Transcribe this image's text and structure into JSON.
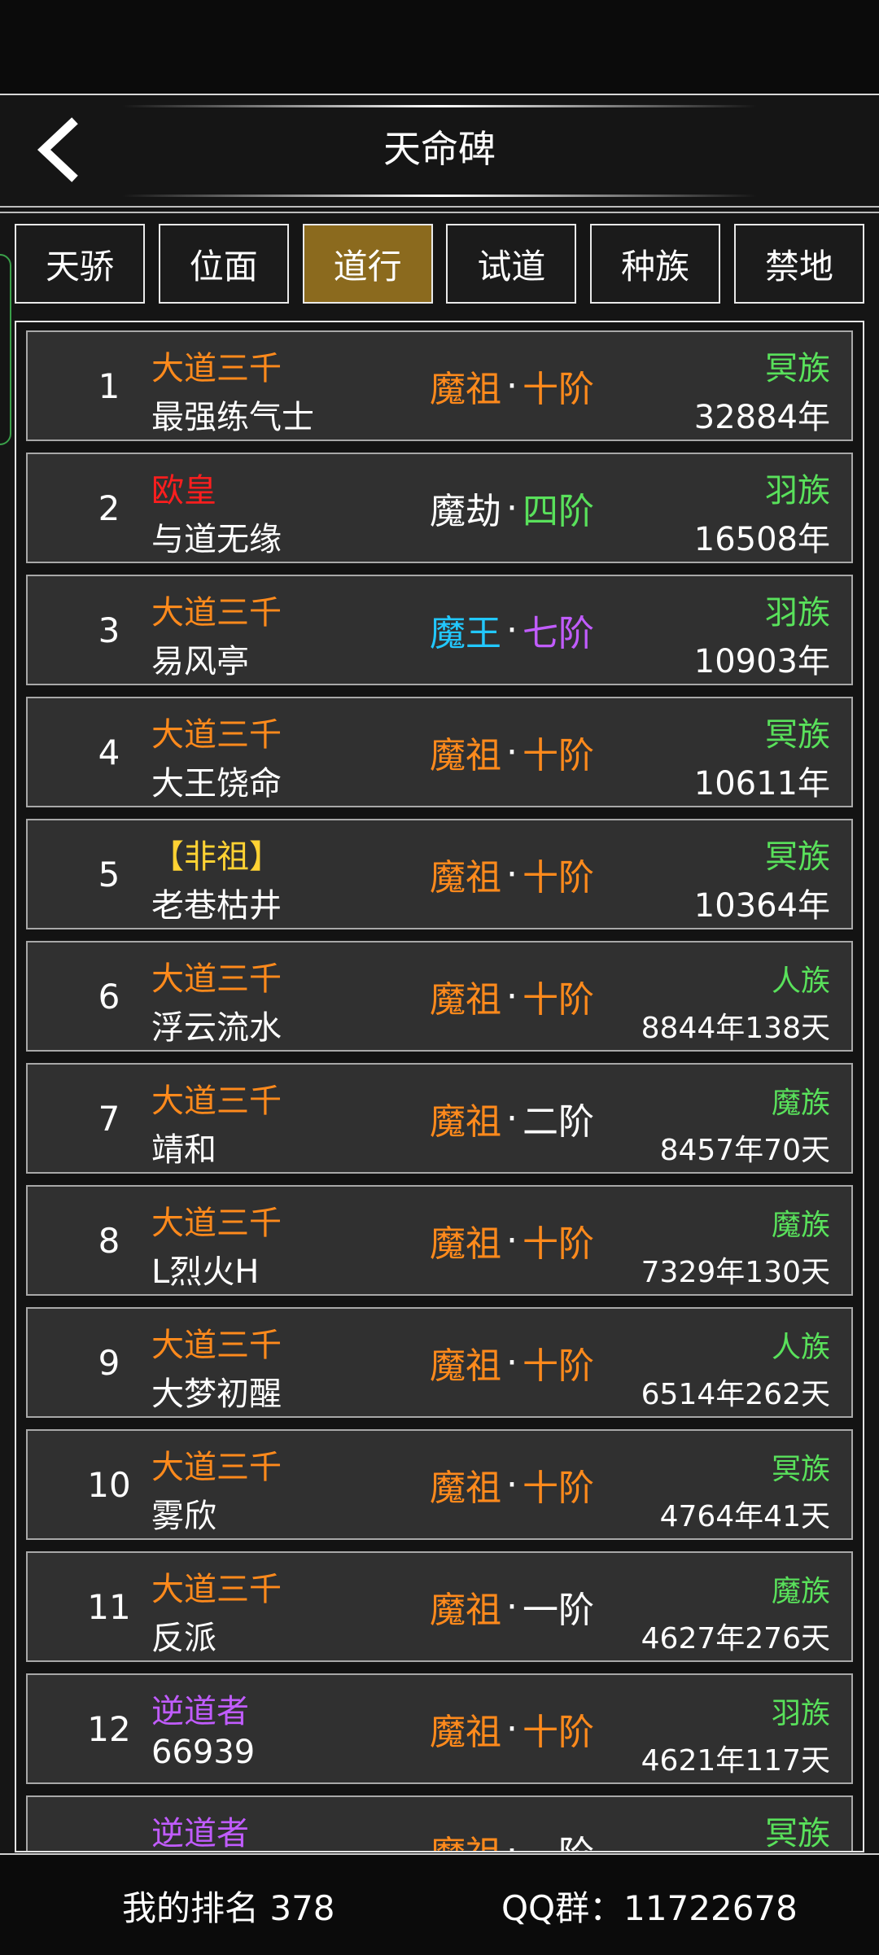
{
  "header": {
    "title": "天命碑"
  },
  "tabs": [
    {
      "label": "天骄",
      "active": false
    },
    {
      "label": "位面",
      "active": false
    },
    {
      "label": "道行",
      "active": true
    },
    {
      "label": "试道",
      "active": false
    },
    {
      "label": "种族",
      "active": false
    },
    {
      "label": "禁地",
      "active": false
    }
  ],
  "colors": {
    "orange": "#ff8a1c",
    "red": "#ff1e1e",
    "green": "#59e15b",
    "cyan": "#22c8ff",
    "purple": "#c15cff",
    "gold": "#ffd233",
    "white": "#ffffff",
    "active_tab": "#8b6a1e"
  },
  "rows": [
    {
      "rank": "1",
      "title": "大道三千",
      "title_color": "orange",
      "name": "最强练气士",
      "realm": "魔祖",
      "realm_color": "orange",
      "stage": "十阶",
      "stage_color": "orange",
      "race": "冥族",
      "age": "32884年"
    },
    {
      "rank": "2",
      "title": "欧皇",
      "title_color": "red",
      "name": "与道无缘",
      "realm": "魔劫",
      "realm_color": "white",
      "stage": "四阶",
      "stage_color": "green",
      "race": "羽族",
      "age": "16508年"
    },
    {
      "rank": "3",
      "title": "大道三千",
      "title_color": "orange",
      "name": "易风亭",
      "realm": "魔王",
      "realm_color": "cyan",
      "stage": "七阶",
      "stage_color": "purple",
      "race": "羽族",
      "age": "10903年"
    },
    {
      "rank": "4",
      "title": "大道三千",
      "title_color": "orange",
      "name": "大王饶命",
      "realm": "魔祖",
      "realm_color": "orange",
      "stage": "十阶",
      "stage_color": "orange",
      "race": "冥族",
      "age": "10611年"
    },
    {
      "rank": "5",
      "title": "【非祖】",
      "title_color": "gold",
      "name": "老巷枯井",
      "realm": "魔祖",
      "realm_color": "orange",
      "stage": "十阶",
      "stage_color": "orange",
      "race": "冥族",
      "age": "10364年"
    },
    {
      "rank": "6",
      "title": "大道三千",
      "title_color": "orange",
      "name": "浮云流水",
      "realm": "魔祖",
      "realm_color": "orange",
      "stage": "十阶",
      "stage_color": "orange",
      "race": "人族",
      "age": "8844年138天"
    },
    {
      "rank": "7",
      "title": "大道三千",
      "title_color": "orange",
      "name": "靖和",
      "realm": "魔祖",
      "realm_color": "orange",
      "stage": "二阶",
      "stage_color": "white",
      "race": "魔族",
      "age": "8457年70天"
    },
    {
      "rank": "8",
      "title": "大道三千",
      "title_color": "orange",
      "name": "L烈火H",
      "realm": "魔祖",
      "realm_color": "orange",
      "stage": "十阶",
      "stage_color": "orange",
      "race": "魔族",
      "age": "7329年130天"
    },
    {
      "rank": "9",
      "title": "大道三千",
      "title_color": "orange",
      "name": "大梦初醒",
      "realm": "魔祖",
      "realm_color": "orange",
      "stage": "十阶",
      "stage_color": "orange",
      "race": "人族",
      "age": "6514年262天"
    },
    {
      "rank": "10",
      "title": "大道三千",
      "title_color": "orange",
      "name": "雾欣",
      "realm": "魔祖",
      "realm_color": "orange",
      "stage": "十阶",
      "stage_color": "orange",
      "race": "冥族",
      "age": "4764年41天"
    },
    {
      "rank": "11",
      "title": "大道三千",
      "title_color": "orange",
      "name": "反派",
      "realm": "魔祖",
      "realm_color": "orange",
      "stage": "一阶",
      "stage_color": "white",
      "race": "魔族",
      "age": "4627年276天"
    },
    {
      "rank": "12",
      "title": "逆道者",
      "title_color": "purple",
      "name": "66939",
      "realm": "魔祖",
      "realm_color": "orange",
      "stage": "十阶",
      "stage_color": "orange",
      "race": "羽族",
      "age": "4621年117天"
    },
    {
      "rank": "",
      "title": "逆道者",
      "title_color": "purple",
      "name": "",
      "realm": "魔祖",
      "realm_color": "orange",
      "stage": "一阶",
      "stage_color": "white",
      "race": "冥族",
      "age": ""
    }
  ],
  "footer": {
    "my_rank": "我的排名 378",
    "qq_group": "QQ群：11722678"
  }
}
